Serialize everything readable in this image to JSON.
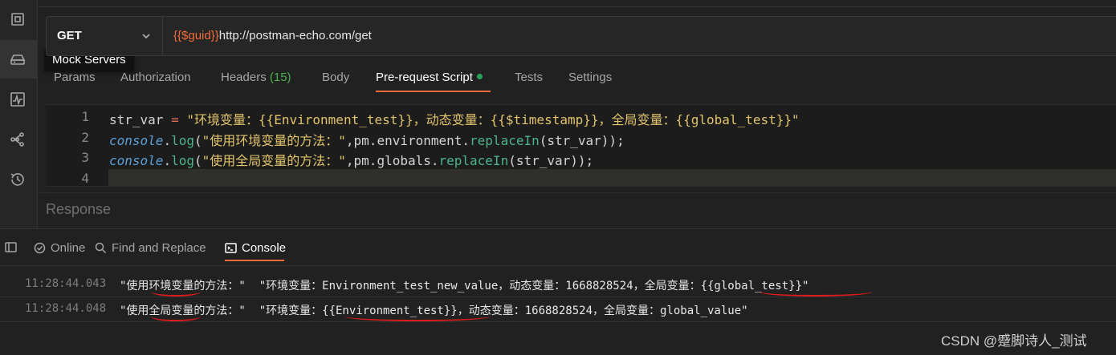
{
  "sidebar": {
    "tooltip": "Mock Servers",
    "icons": [
      "api-icon",
      "mock-server-icon",
      "monitor-icon",
      "flows-icon",
      "history-icon"
    ]
  },
  "request": {
    "method": "GET",
    "url_var": "{{$guid}}",
    "url_rest": "http://postman-echo.com/get"
  },
  "tabs": [
    {
      "label": "Params"
    },
    {
      "label": "Authorization"
    },
    {
      "label": "Headers",
      "count": "(15)"
    },
    {
      "label": "Body"
    },
    {
      "label": "Pre-request Script"
    },
    {
      "label": "Tests"
    },
    {
      "label": "Settings"
    }
  ],
  "editor": {
    "line_numbers": [
      "1",
      "2",
      "3",
      "4"
    ],
    "lines": [
      {
        "p1": "str_var",
        "p2": " = ",
        "p3": "\"环境变量：{{Environment_test}}，动态变量：{{$timestamp}}，全局变量：{{global_test}}\""
      },
      {
        "obj": "console",
        "dot": ".",
        "fn": "log",
        "open": "(",
        "str": "\"使用环境变量的方法：\"",
        "mid": ",pm.environment.",
        "fn2": "replaceIn",
        "end": "(str_var));"
      },
      {
        "obj": "console",
        "dot": ".",
        "fn": "log",
        "open": "(",
        "str": "\"使用全局变量的方法：\"",
        "mid": ",pm.globals.",
        "fn2": "replaceIn",
        "end": "(str_var));"
      }
    ]
  },
  "response": {
    "label": "Response"
  },
  "console": {
    "toolbar": {
      "online": "Online",
      "find_replace": "Find and Replace",
      "console": "Console"
    },
    "logs": [
      {
        "time": "11:28:44.043",
        "message": "\"使用环境变量的方法：\"  \"环境变量：Environment_test_new_value，动态变量：1668828524，全局变量：{{global_test}}\""
      },
      {
        "time": "11:28:44.048",
        "message": "\"使用全局变量的方法：\"  \"环境变量：{{Environment_test}}，动态变量：1668828524，全局变量：global_value\""
      }
    ]
  },
  "watermark": "CSDN @蹙脚诗人_测试",
  "colors": {
    "accent": "#f26b3a",
    "green": "#25a35a",
    "annotation": "#e01a1a"
  }
}
